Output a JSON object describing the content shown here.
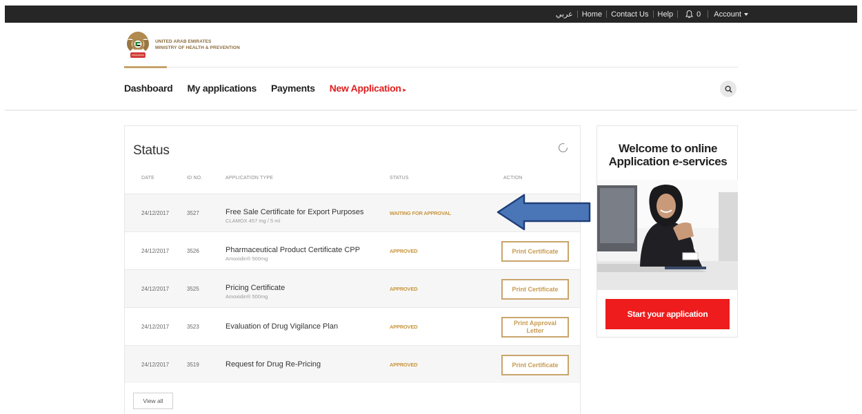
{
  "topbar": {
    "arabic": "عربي",
    "home": "Home",
    "contact": "Contact Us",
    "help": "Help",
    "notifications_count": "0",
    "account": "Account"
  },
  "logo": {
    "line1": "UNITED ARAB EMIRATES",
    "line2": "MINISTRY OF HEALTH & PREVENTION"
  },
  "nav": {
    "dashboard": "Dashboard",
    "my_applications": "My applications",
    "payments": "Payments",
    "new_application": "New Application"
  },
  "status": {
    "title": "Status",
    "headers": {
      "date": "DATE",
      "id": "ID NO.",
      "type": "APPLICATION TYPE",
      "status": "STATUS",
      "action": "ACTION"
    },
    "rows": [
      {
        "date": "24/12/2017",
        "id": "3527",
        "type": "Free Sale Certificate for Export Purposes",
        "sub": "CLAMOX 457 mg / 5 ml",
        "status": "WAITING FOR APPROVAL",
        "action": ""
      },
      {
        "date": "24/12/2017",
        "id": "3526",
        "type": "Pharmaceutical Product Certificate CPP",
        "sub": "Amoxidin® 500mg",
        "status": "APPROVED",
        "action": "Print Certificate"
      },
      {
        "date": "24/12/2017",
        "id": "3525",
        "type": "Pricing Certificate",
        "sub": "Amoxidin® 500mg",
        "status": "APPROVED",
        "action": "Print Certificate"
      },
      {
        "date": "24/12/2017",
        "id": "3523",
        "type": "Evaluation of Drug Vigilance Plan",
        "sub": "",
        "status": "APPROVED",
        "action": "Print Approval Letter"
      },
      {
        "date": "24/12/2017",
        "id": "3519",
        "type": "Request for Drug Re-Pricing",
        "sub": "",
        "status": "APPROVED",
        "action": "Print Certificate"
      }
    ],
    "view_all": "View all"
  },
  "welcome": {
    "title_line1": "Welcome to online",
    "title_line2": "Application e-services",
    "start_button": "Start your application"
  },
  "colors": {
    "topbar": "#262626",
    "accent_red": "#e01e1e",
    "gold": "#c9a46a",
    "arrow_blue": "#4a76b8"
  }
}
